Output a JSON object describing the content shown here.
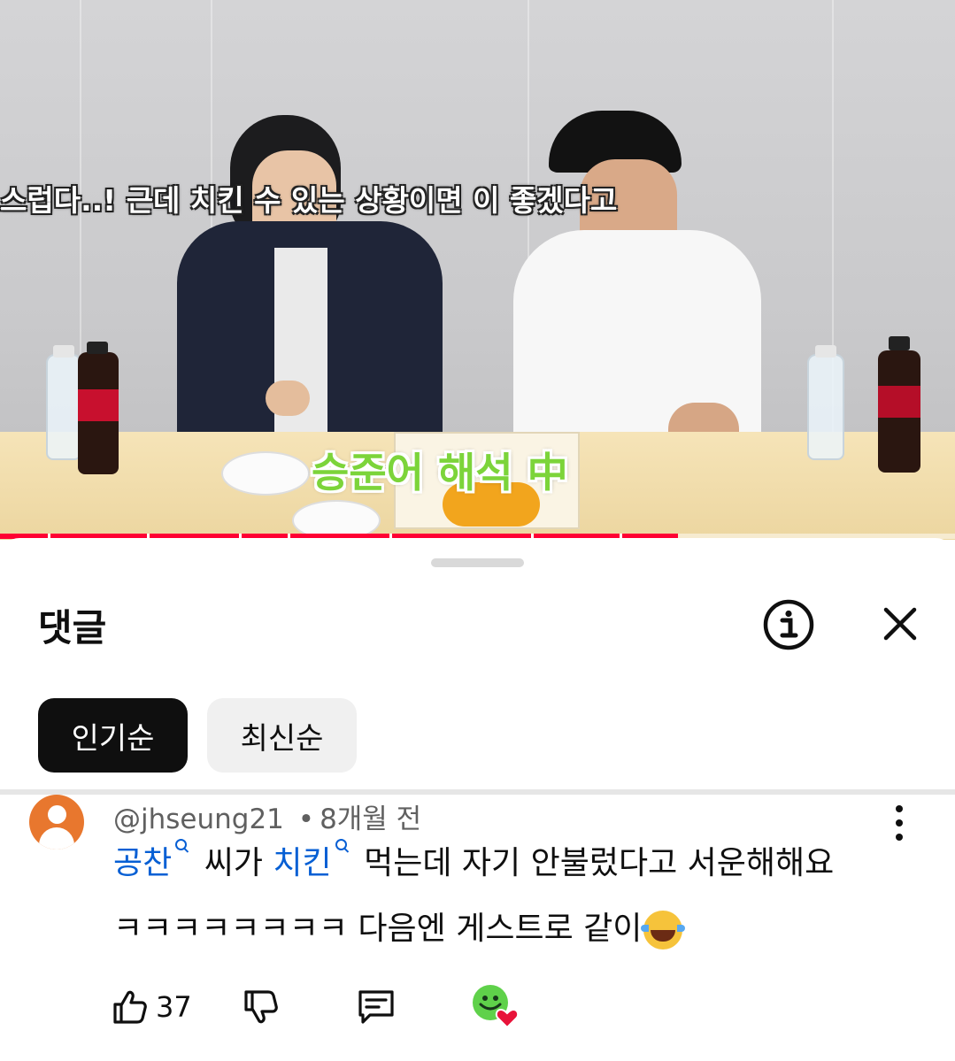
{
  "video": {
    "subtitle": "스럽다..! 근데 치킨  수 있는 상황이면 이  좋겠다고",
    "caption": "승준어 해석 中",
    "progress_fraction": 0.71
  },
  "comments_panel": {
    "title": "댓글",
    "info_icon": "info-icon",
    "close_icon": "close-icon",
    "sort_chips": [
      {
        "label": "인기순",
        "selected": true
      },
      {
        "label": "최신순",
        "selected": false
      }
    ]
  },
  "comments": [
    {
      "author": "@jhseung21",
      "separator": "•",
      "time": "8개월 전",
      "line1": {
        "tag1": "공찬",
        "text1": "씨가",
        "tag2": "치킨",
        "text2": "먹는데 자기 안불렀다고 서운해해요"
      },
      "line2": "ㅋㅋㅋㅋㅋㅋㅋㅋ 다음엔 게스트로 같이",
      "line2_emoji": "tears-of-joy-emoji",
      "likes": "37"
    }
  ],
  "colors": {
    "link": "#065fd4",
    "progress": "#ff0033",
    "avatar": "#e8772e",
    "chip_active": "#0f0f0f",
    "chip_inactive": "#f0f0f0"
  }
}
